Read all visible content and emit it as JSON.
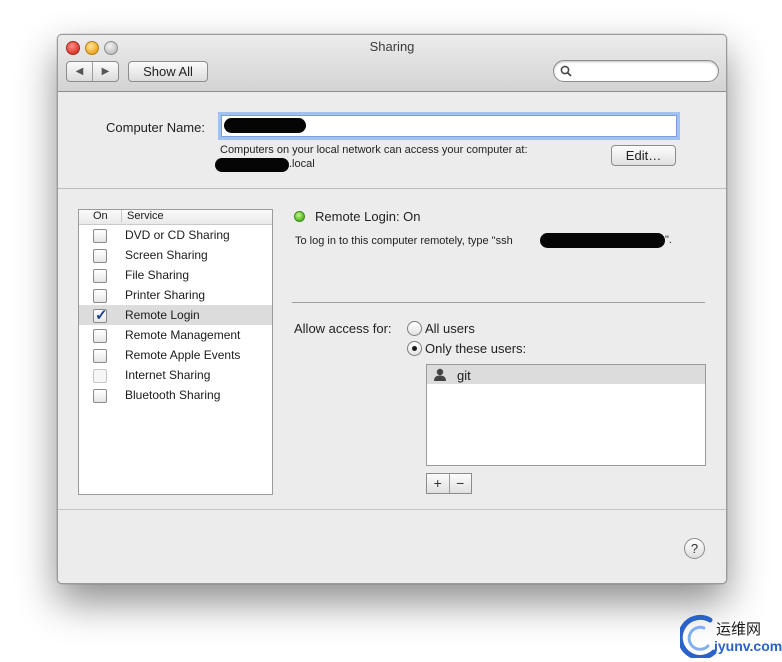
{
  "window": {
    "title": "Sharing",
    "nav_back": "◀",
    "nav_forward": "▶",
    "show_all_label": "Show All",
    "search_placeholder": ""
  },
  "computer_name": {
    "label": "Computer Name:",
    "value": "",
    "network_message": "Computers on your local network can access your computer at:",
    "local_suffix": ".local",
    "edit_label": "Edit…"
  },
  "services": {
    "header_on": "On",
    "header_service": "Service",
    "items": [
      {
        "label": "DVD or CD Sharing",
        "checked": false,
        "enabled": true,
        "selected": false
      },
      {
        "label": "Screen Sharing",
        "checked": false,
        "enabled": true,
        "selected": false
      },
      {
        "label": "File Sharing",
        "checked": false,
        "enabled": true,
        "selected": false
      },
      {
        "label": "Printer Sharing",
        "checked": false,
        "enabled": true,
        "selected": false
      },
      {
        "label": "Remote Login",
        "checked": true,
        "enabled": true,
        "selected": true
      },
      {
        "label": "Remote Management",
        "checked": false,
        "enabled": true,
        "selected": false
      },
      {
        "label": "Remote Apple Events",
        "checked": false,
        "enabled": true,
        "selected": false
      },
      {
        "label": "Internet Sharing",
        "checked": false,
        "enabled": false,
        "selected": false
      },
      {
        "label": "Bluetooth Sharing",
        "checked": false,
        "enabled": true,
        "selected": false
      }
    ]
  },
  "detail": {
    "status_label": "Remote Login: On",
    "status_color": "#5ec22a",
    "instructions_prefix": "To log in to this computer remotely, type \"ssh",
    "instructions_suffix": "\".",
    "access_label": "Allow access for:",
    "option_all": "All users",
    "option_only": "Only these users:",
    "selected_option": "only",
    "users": [
      "git"
    ],
    "add_label": "+",
    "remove_label": "−",
    "help_label": "?"
  },
  "watermark": {
    "chinese": "运维网",
    "domain": "iyunv.com"
  }
}
